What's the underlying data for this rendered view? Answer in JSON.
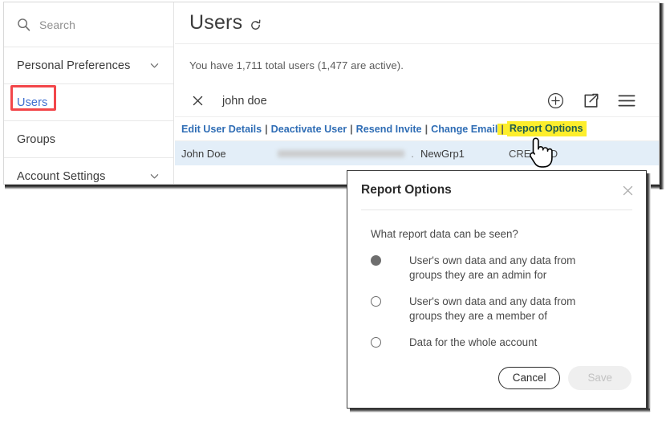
{
  "colors": {
    "link_blue": "#2f6db5",
    "sidebar_link_blue": "#3f6fd0",
    "highlight_yellow": "#fdee2c",
    "annotation_red": "#f2464a",
    "row_selected_blue": "#e3eef8",
    "highlight_link_text": "#1f5b4e"
  },
  "sidebar": {
    "search": {
      "icon": "search-icon",
      "placeholder": "Search",
      "value": ""
    },
    "items": [
      {
        "label": "Personal Preferences",
        "icon": "chevron-down-icon",
        "expandable": true,
        "active": false
      },
      {
        "label": "Users",
        "icon": "",
        "expandable": false,
        "active": true
      },
      {
        "label": "Groups",
        "icon": "",
        "expandable": false,
        "active": false
      },
      {
        "label": "Account Settings",
        "icon": "chevron-down-icon",
        "expandable": true,
        "active": false
      }
    ]
  },
  "main": {
    "title": "Users",
    "title_icon": "refresh-icon",
    "summary": "You have 1,711 total users (1,477 are active).",
    "search_chip": {
      "clear_icon": "close-icon",
      "term": "john doe"
    },
    "toolbar": [
      {
        "name": "add-user-icon",
        "label": "Add"
      },
      {
        "name": "export-icon",
        "label": "Export"
      },
      {
        "name": "menu-icon",
        "label": "Menu"
      }
    ],
    "action_links": [
      "Edit User Details",
      "Deactivate User",
      "Resend Invite",
      "Change Email",
      "Report Options"
    ],
    "action_separator": "|",
    "highlighted_action": "Report Options",
    "user_row": {
      "name": "John Doe",
      "email": "",
      "email_redacted_dot": ".",
      "group": "NewGrp1",
      "status": "CREATED"
    }
  },
  "dialog": {
    "title": "Report Options",
    "close_icon": "close-icon",
    "question": "What report data can be seen?",
    "options": [
      {
        "label": "User's own data and any data from groups they are an admin for",
        "selected": true
      },
      {
        "label": "User's own data and any data from groups they are a member of",
        "selected": false
      },
      {
        "label": "Data for the whole account",
        "selected": false
      }
    ],
    "cancel_label": "Cancel",
    "save_label": "Save",
    "save_disabled": true
  },
  "cursor": {
    "type": "pointing-hand-cursor"
  }
}
